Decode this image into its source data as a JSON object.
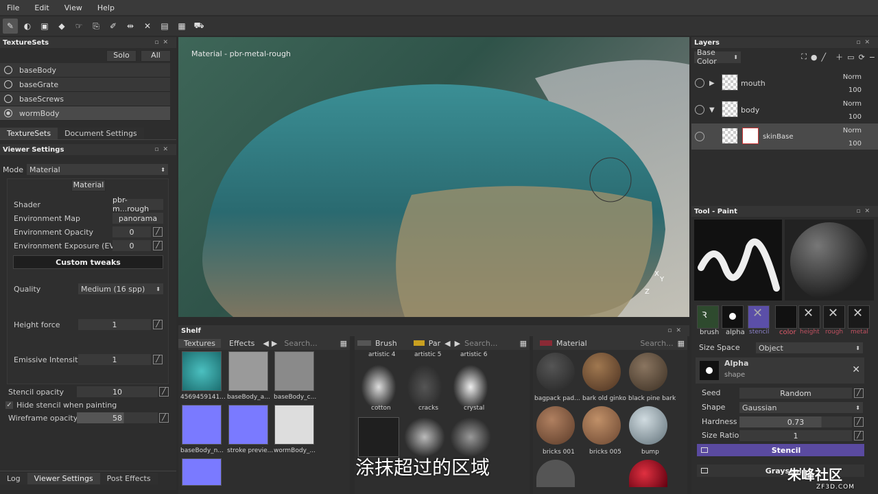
{
  "menu": [
    "File",
    "Edit",
    "View",
    "Help"
  ],
  "texturesets": {
    "title": "TextureSets",
    "solo": "Solo",
    "all": "All",
    "items": [
      "baseBody",
      "baseGrate",
      "baseScrews",
      "wormBody"
    ],
    "tabs": [
      "TextureSets",
      "Document Settings"
    ]
  },
  "viewer": {
    "title": "Viewer Settings",
    "mode_label": "Mode",
    "mode_value": "Material",
    "section": "Material",
    "shader_label": "Shader",
    "shader_value": "pbr-m...rough",
    "envmap_label": "Environment Map",
    "envmap_value": "panorama",
    "envop_label": "Environment Opacity",
    "envop_value": "0",
    "envexp_label": "Environment Exposure (EV)",
    "envexp_value": "0",
    "custom_tweaks": "Custom tweaks",
    "quality_label": "Quality",
    "quality_value": "Medium (16 spp)",
    "height_label": "Height force",
    "height_value": "1",
    "emissive_label": "Emissive Intensity",
    "emissive_value": "1",
    "stencil_label": "Stencil opacity",
    "stencil_value": "10",
    "hide_stencil": "Hide stencil when painting",
    "wire_label": "Wireframe opacity",
    "wire_value": "58"
  },
  "bottom_tabs": [
    "Log",
    "Viewer Settings",
    "Post Effects"
  ],
  "viewport": {
    "label": "Material - pbr-metal-rough",
    "subtitle": "涂抹超过的区域",
    "axis_x": "X",
    "axis_y": "Y",
    "axis_z": "Z"
  },
  "shelf": {
    "title": "Shelf",
    "tabs1": [
      "Textures",
      "Effects"
    ],
    "search": "Search...",
    "tex_items": [
      "4569459141...",
      "baseBody_a...",
      "baseBody_c...",
      "baseBody_n...",
      "stroke previe...",
      "wormBody_..."
    ],
    "brush_tab": "Brush",
    "par_tab": "Par",
    "brush_items": [
      "artistic 4",
      "artistic 5",
      "artistic 6",
      "cotton",
      "cracks",
      "crystal"
    ],
    "material_tab": "Material",
    "mat_items": [
      "bagpack pad...",
      "bark old ginko",
      "black pine bark",
      "bricks 001",
      "bricks 005",
      "bump"
    ]
  },
  "layers": {
    "title": "Layers",
    "channel": "Base Color",
    "items": [
      {
        "name": "mouth",
        "blend": "Norm",
        "opacity": "100"
      },
      {
        "name": "body",
        "blend": "Norm",
        "opacity": "100"
      },
      {
        "name": "skinBase",
        "blend": "Norm",
        "opacity": "100"
      }
    ]
  },
  "tool": {
    "title": "Tool - Paint",
    "slots": [
      "brush",
      "alpha",
      "stencil",
      "color",
      "height",
      "rough",
      "metal"
    ],
    "size_space_label": "Size Space",
    "size_space_value": "Object",
    "alpha_name": "Alpha",
    "alpha_sub": "shape",
    "seed_label": "Seed",
    "seed_value": "Random",
    "shape_label": "Shape",
    "shape_value": "Gaussian",
    "hardness_label": "Hardness",
    "hardness_value": "0.73",
    "ratio_label": "Size Ratio",
    "ratio_value": "1",
    "stencil_section": "Stencil",
    "grayscale": "Grayscale"
  },
  "watermark": "朱峰社区",
  "watermark_url": "ZF3D.COM",
  "colors": {
    "accent": "#5b4fa8",
    "stencil_bar": "#5a4aa0"
  }
}
